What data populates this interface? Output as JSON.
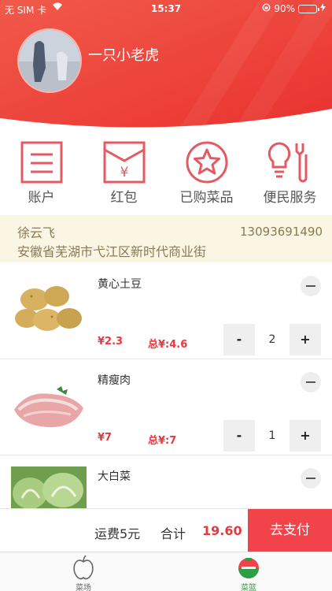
{
  "status_bar": {
    "carrier": "无 SIM 卡",
    "time": "15:37",
    "battery": "90%",
    "battery_level": 0.9
  },
  "profile": {
    "username": "一只小老虎"
  },
  "menu": {
    "items": [
      {
        "label": "账户",
        "icon": "bill-list-icon"
      },
      {
        "label": "红包",
        "icon": "red-envelope-icon"
      },
      {
        "label": "已购菜品",
        "icon": "star-icon"
      },
      {
        "label": "便民服务",
        "icon": "bulb-wrench-icon"
      }
    ]
  },
  "address": {
    "name": "徐云飞",
    "phone": "13093691490",
    "street": "安徽省芜湖市弋江区新时代商业街"
  },
  "cart": {
    "items": [
      {
        "name": "黄心土豆",
        "price": "¥2.3",
        "total": "总¥:4.6",
        "qty": "2",
        "minus": "-",
        "plus": "+"
      },
      {
        "name": "精瘦肉",
        "price": "¥7",
        "total": "总¥:7",
        "qty": "1",
        "minus": "-",
        "plus": "+"
      },
      {
        "name": "大白菜"
      }
    ]
  },
  "checkout": {
    "shipping": "运费5元",
    "sum_label": "合计",
    "sum_value": "19.60",
    "pay_button": "去支付"
  },
  "tabbar": {
    "tabs": [
      {
        "label": "菜场",
        "icon": "apple-icon",
        "active": false
      },
      {
        "label": "菜篮",
        "icon": "basket-icon",
        "active": true
      }
    ]
  },
  "colors": {
    "primary_red": "#f2434b",
    "header_red": "#ee3b36",
    "active_green": "#2e9e44",
    "icon_red": "#e35a63"
  }
}
